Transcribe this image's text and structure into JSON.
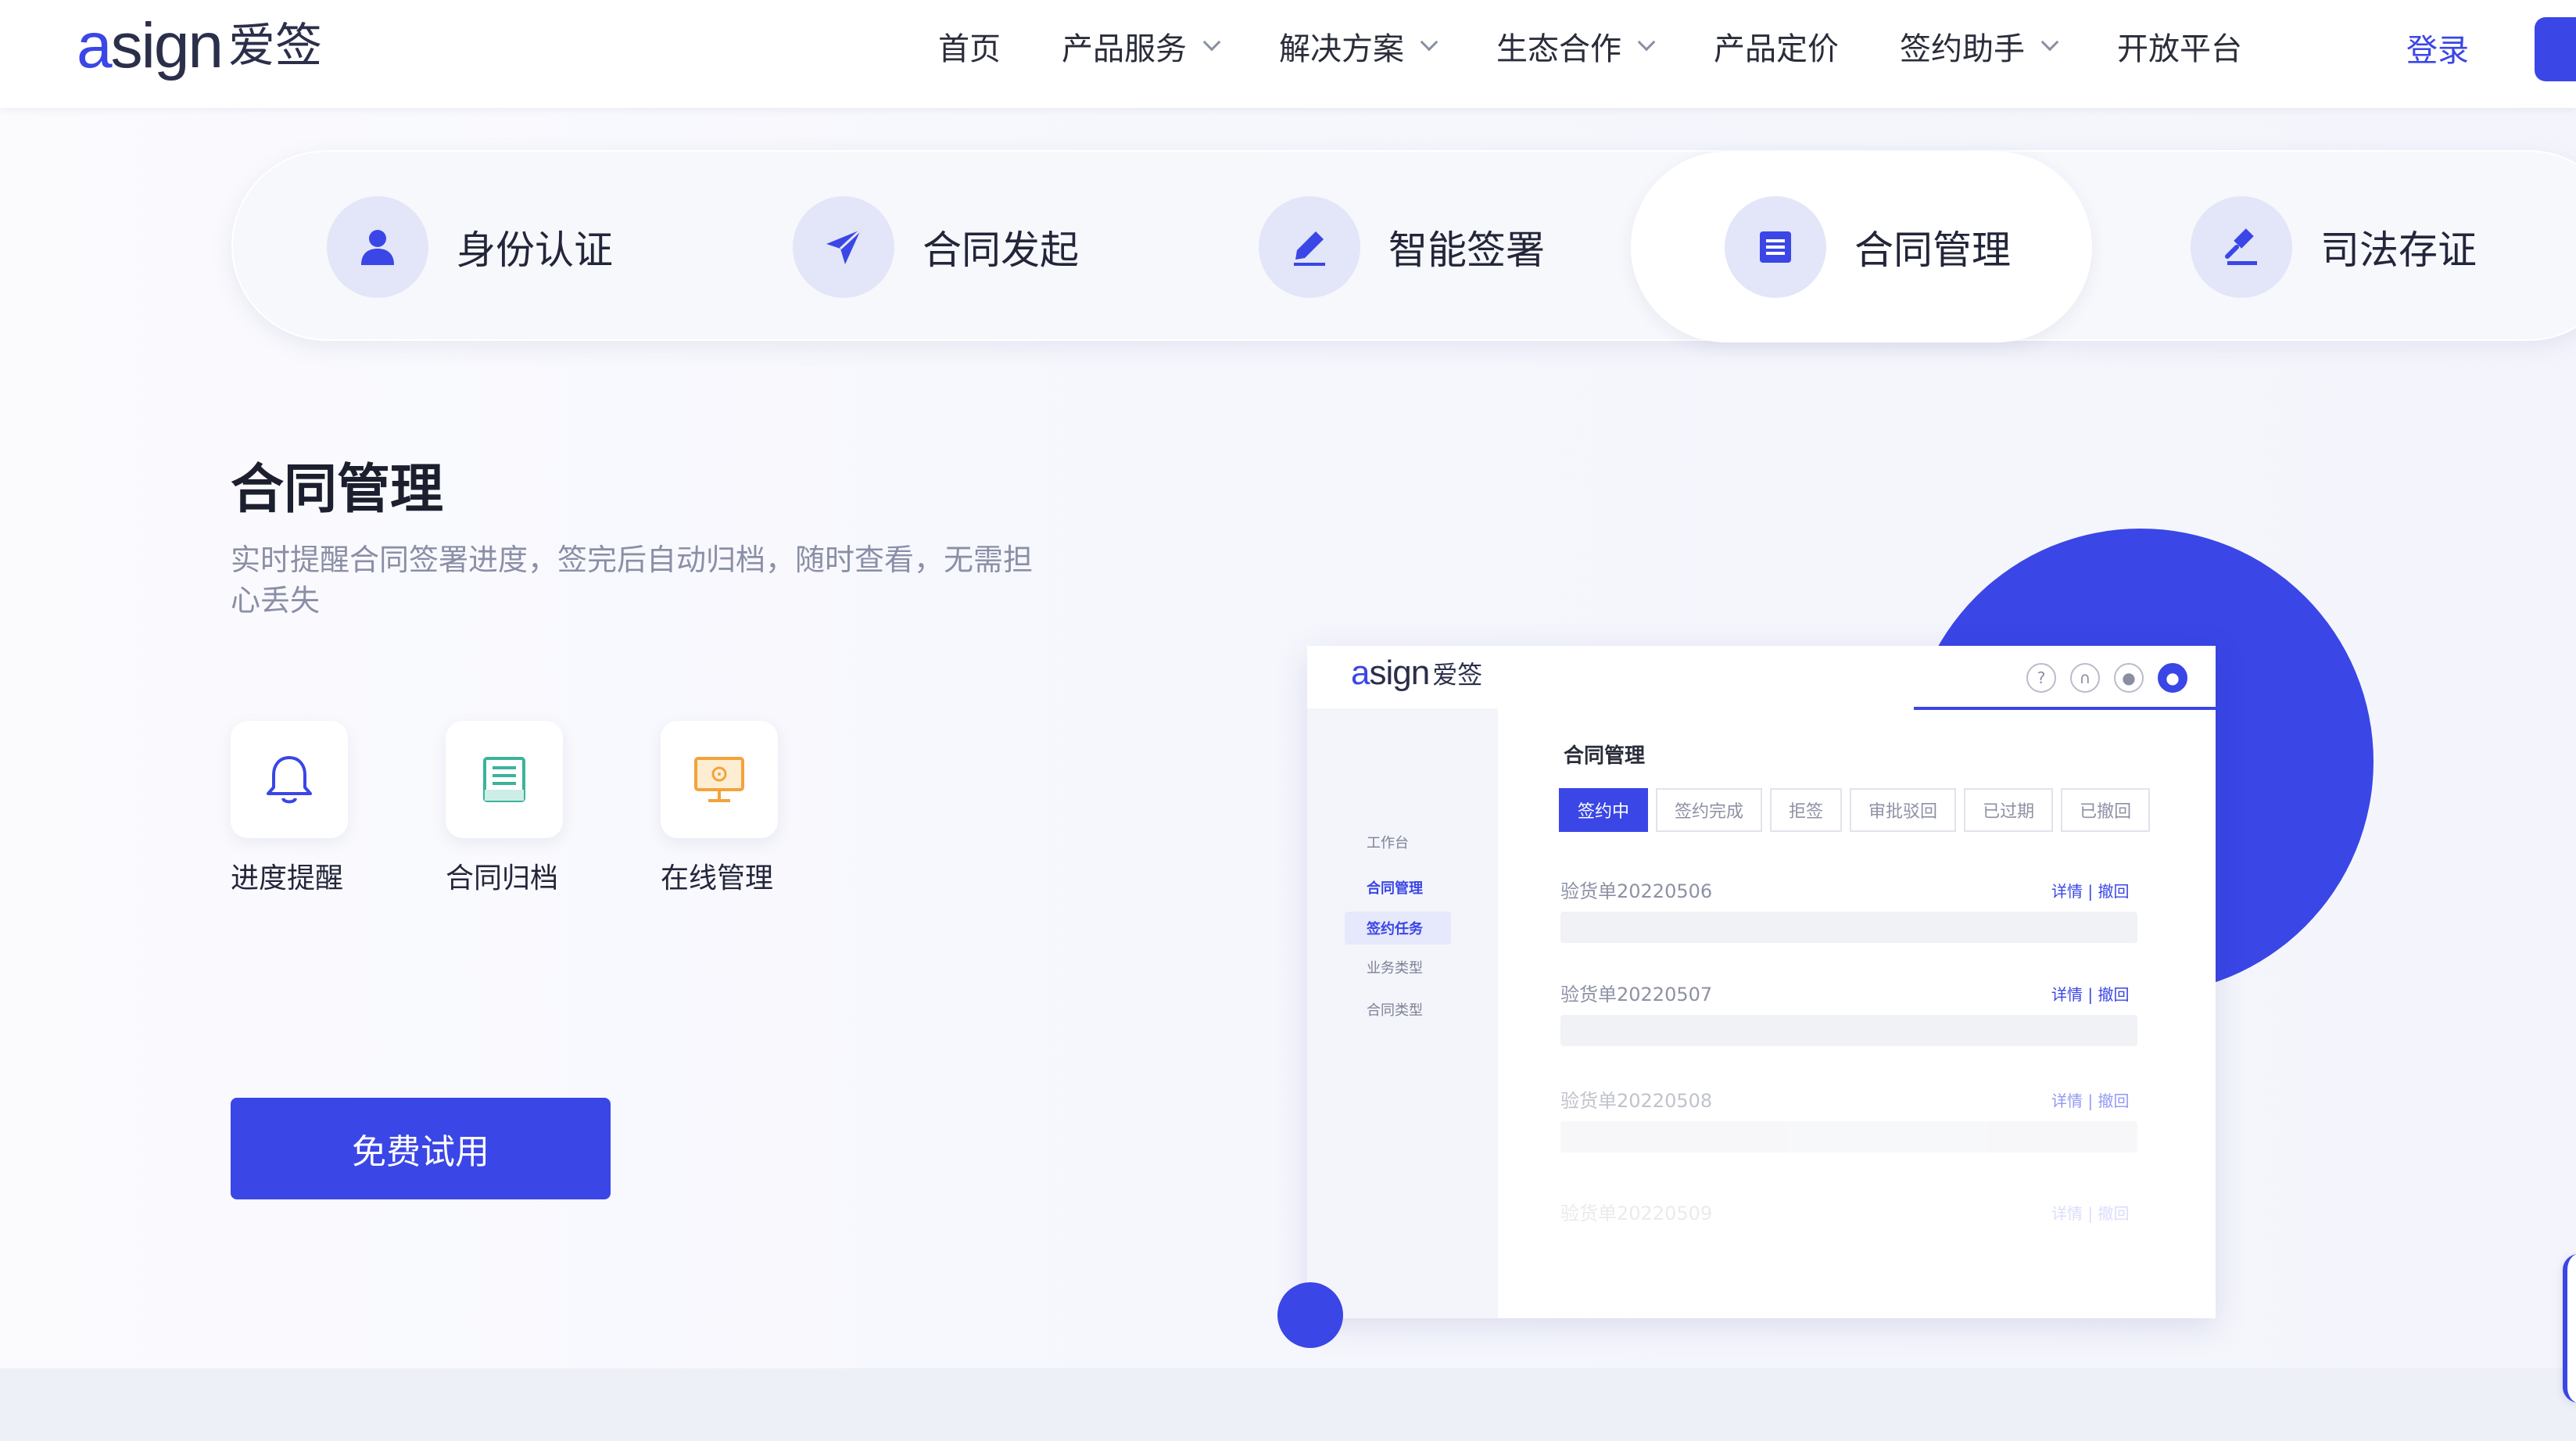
{
  "header": {
    "logo_word_a": "a",
    "logo_word_rest": "sign",
    "logo_cn": "爱签",
    "nav": [
      {
        "label": "首页",
        "has_dropdown": false
      },
      {
        "label": "产品服务",
        "has_dropdown": true
      },
      {
        "label": "解决方案",
        "has_dropdown": true
      },
      {
        "label": "生态合作",
        "has_dropdown": true
      },
      {
        "label": "产品定价",
        "has_dropdown": false
      },
      {
        "label": "签约助手",
        "has_dropdown": true
      },
      {
        "label": "开放平台",
        "has_dropdown": false
      }
    ],
    "login_label": "登录"
  },
  "feature_tabs": {
    "active_index": 3,
    "items": [
      {
        "label": "身份认证",
        "icon": "user-icon"
      },
      {
        "label": "合同发起",
        "icon": "send-icon"
      },
      {
        "label": "智能签署",
        "icon": "pen-icon"
      },
      {
        "label": "合同管理",
        "icon": "document-icon"
      },
      {
        "label": "司法存证",
        "icon": "gavel-icon"
      }
    ]
  },
  "hero": {
    "title": "合同管理",
    "description": "实时提醒合同签署进度，签完后自动归档，随时查看，无需担心丢失",
    "features": [
      {
        "label": "进度提醒",
        "icon": "bell-icon"
      },
      {
        "label": "合同归档",
        "icon": "archive-icon"
      },
      {
        "label": "在线管理",
        "icon": "monitor-icon"
      }
    ],
    "cta_label": "免费试用"
  },
  "mockup": {
    "logo_word_a": "a",
    "logo_word_rest": "sign",
    "logo_cn": "爱签",
    "header_icons": [
      "help-icon",
      "headset-icon",
      "bell-icon",
      "user-icon"
    ],
    "sidebar": [
      "工作台",
      "合同管理",
      "签约任务",
      "业务类型",
      "合同类型"
    ],
    "title": "合同管理",
    "tabs": [
      "签约中",
      "签约完成",
      "拒签",
      "审批驳回",
      "已过期",
      "已撤回"
    ],
    "rows": [
      {
        "name": "验货单20220506",
        "detail": "详情",
        "withdraw": "撤回"
      },
      {
        "name": "验货单20220507",
        "detail": "详情",
        "withdraw": "撤回"
      },
      {
        "name": "验货单20220508",
        "detail": "详情",
        "withdraw": "撤回"
      },
      {
        "name": "验货单20220509",
        "detail": "详情",
        "withdraw": "撤回"
      }
    ]
  },
  "colors": {
    "brand": "#3a46e6",
    "icon_bg": "#e3e5f8",
    "text_muted": "#8a8fa6"
  }
}
